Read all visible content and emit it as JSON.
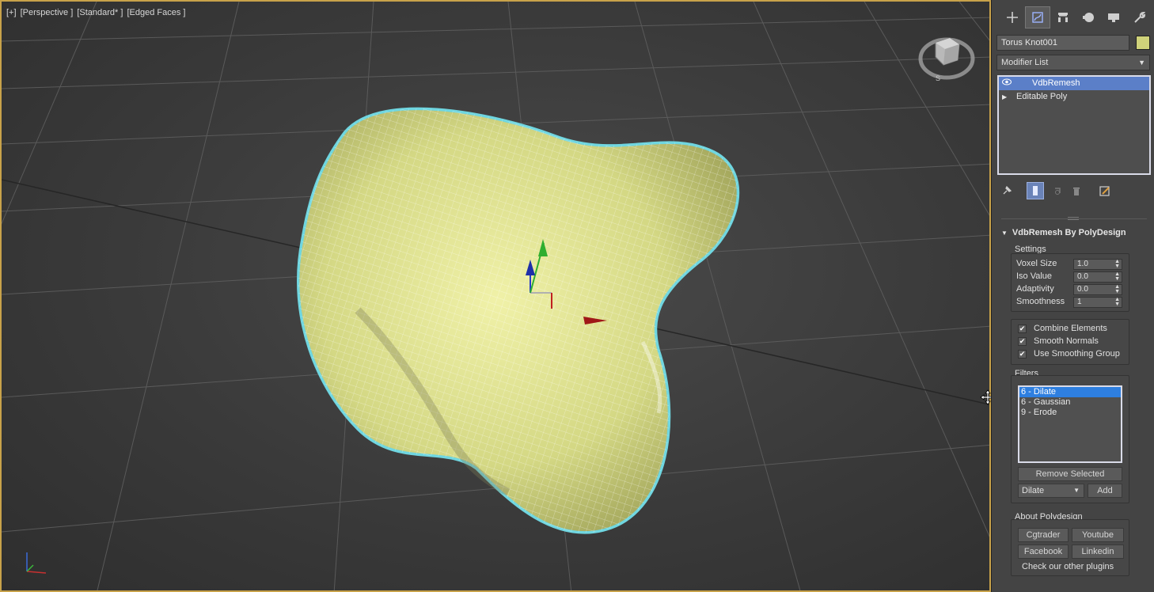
{
  "viewport": {
    "label_parts": [
      "[+]",
      "[Perspective ]",
      "[Standard* ]",
      "[Edged Faces ]"
    ],
    "viewcube_compass_letter": "S",
    "object_color": "#d8dd86",
    "wire_color": "#6fd6e0"
  },
  "panel": {
    "tabs": [
      {
        "name": "create",
        "icon": "+"
      },
      {
        "name": "modify",
        "icon": "modify-icon"
      },
      {
        "name": "hierarchy",
        "icon": "hierarchy-icon"
      },
      {
        "name": "motion",
        "icon": "motion-icon"
      },
      {
        "name": "display",
        "icon": "display-icon"
      },
      {
        "name": "utilities",
        "icon": "wrench-icon"
      }
    ],
    "object_name": "Torus Knot001",
    "object_color": "#cfd27a",
    "modifier_list_label": "Modifier List",
    "stack": [
      {
        "label": "VdbRemesh",
        "selected": true,
        "icon": "eye-icon"
      },
      {
        "label": "Editable Poly",
        "selected": false,
        "icon": "expand-triangle-icon"
      }
    ],
    "rollout_title": "VdbRemesh By PolyDesign",
    "settings": {
      "title": "Settings",
      "params": [
        {
          "label": "Voxel Size",
          "value": "1.0"
        },
        {
          "label": "Iso Value",
          "value": "0.0"
        },
        {
          "label": "Adaptivity",
          "value": "0.0"
        },
        {
          "label": "Smoothness",
          "value": "1"
        }
      ]
    },
    "options": [
      {
        "label": "Combine Elements",
        "checked": true
      },
      {
        "label": "Smooth Normals",
        "checked": true
      },
      {
        "label": "Use Smoothing Group",
        "checked": true
      }
    ],
    "filters": {
      "title": "Filters",
      "items": [
        {
          "label": "6 - Dilate",
          "selected": true
        },
        {
          "label": "6 - Gaussian",
          "selected": false
        },
        {
          "label": "9 - Erode",
          "selected": false
        }
      ],
      "remove_selected_label": "Remove Selected",
      "filter_type_value": "Dilate",
      "add_label": "Add"
    },
    "about": {
      "title": "About Polydesign",
      "cgtrader_label": "Cgtrader",
      "youtube_label": "Youtube",
      "facebook_label": "Facebook",
      "linkedin_label": "Linkedin",
      "other_plugins_label": "Check our other plugins"
    }
  }
}
